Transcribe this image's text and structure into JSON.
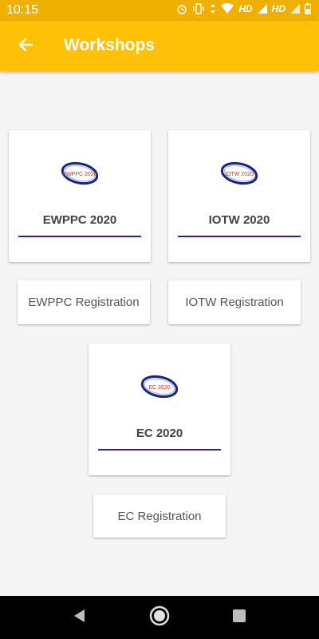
{
  "status_bar": {
    "time": "10:15",
    "hd1": "HD",
    "hd2": "HD",
    "icons": [
      "alarm-icon",
      "vibrate-icon",
      "data-arrows-icon",
      "wifi-icon",
      "signal-icon",
      "battery-icon"
    ]
  },
  "app_bar": {
    "title": "Workshops",
    "back_icon": "arrow-left-icon",
    "color": "#ffc107"
  },
  "workshops": [
    {
      "title": "EWPPC 2020",
      "logo_text": "EWPPC 2020",
      "register_label": "EWPPC Registration"
    },
    {
      "title": "IOTW 2020",
      "logo_text": "IOTW 2020",
      "register_label": "IOTW Registration"
    },
    {
      "title": "EC 2020",
      "logo_text": "EC 2020",
      "register_label": "EC Registration"
    }
  ],
  "nav_bar": {
    "icons": [
      "back-triangle-icon",
      "home-circle-icon",
      "recents-square-icon"
    ]
  },
  "colors": {
    "status_bar": "#f0b000",
    "accent_line": "#3f1d87",
    "logo_ring": "#1a237e",
    "logo_text": "#c0392b"
  }
}
